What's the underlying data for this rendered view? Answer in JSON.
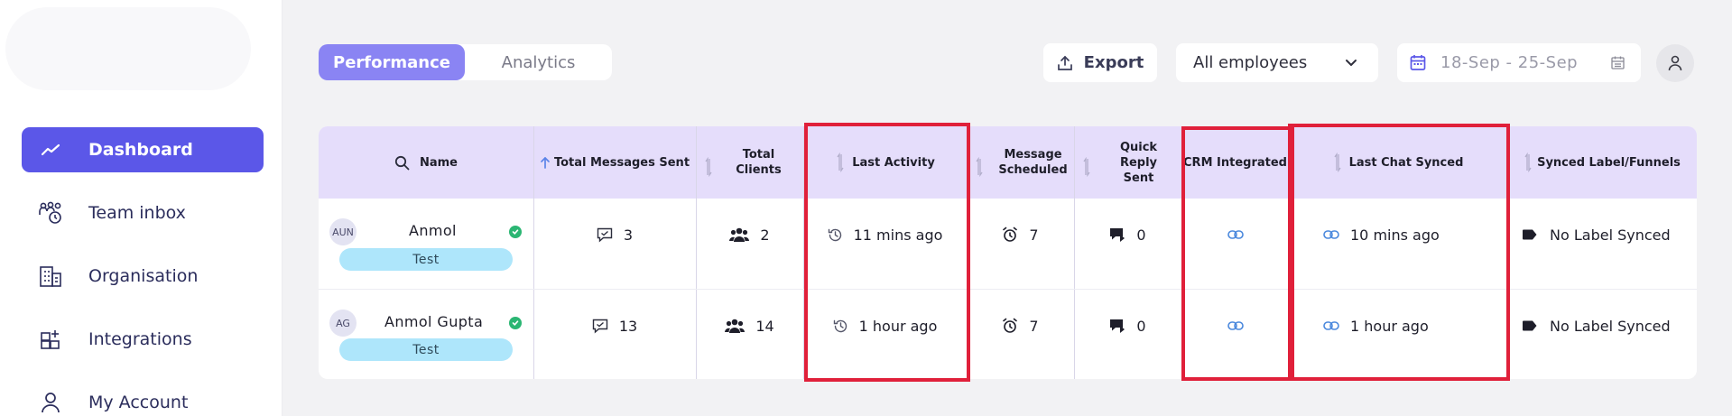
{
  "sidebar": {
    "items": [
      {
        "label": "Dashboard",
        "icon": "trend-line-icon",
        "active": true
      },
      {
        "label": "Team inbox",
        "icon": "team-clock-icon",
        "active": false
      },
      {
        "label": "Organisation",
        "icon": "building-icon",
        "active": false
      },
      {
        "label": "Integrations",
        "icon": "grid-plus-icon",
        "active": false
      },
      {
        "label": "My Account",
        "icon": "user-icon",
        "active": false
      }
    ]
  },
  "topbar": {
    "tabs": [
      {
        "label": "Performance",
        "active": true
      },
      {
        "label": "Analytics",
        "active": false
      }
    ],
    "export_label": "Export",
    "employee_filter": "All employees",
    "date_range": "18-Sep - 25-Sep"
  },
  "table": {
    "headers": {
      "name": "Name",
      "total_messages": "Total Messages Sent",
      "total_clients": "Total Clients",
      "last_activity": "Last Activity",
      "message_scheduled": "Message Scheduled",
      "quick_reply": "Quick Reply Sent",
      "crm": "CRM Integrated",
      "last_chat_synced": "Last Chat Synced",
      "synced_label": "Synced Label/Funnels"
    },
    "rows": [
      {
        "initials": "AUN",
        "name": "Anmol",
        "tag": "Test",
        "messages_sent": "3",
        "clients": "2",
        "last_activity": "11 mins ago",
        "scheduled": "7",
        "quick_reply": "0",
        "last_chat_synced": "10 mins ago",
        "synced_label": "No Label Synced"
      },
      {
        "initials": "AG",
        "name": "Anmol Gupta",
        "tag": "Test",
        "messages_sent": "13",
        "clients": "14",
        "last_activity": "1 hour ago",
        "scheduled": "7",
        "quick_reply": "0",
        "last_chat_synced": "1 hour ago",
        "synced_label": "No Label Synced"
      }
    ]
  },
  "colors": {
    "accent": "#5b57e8",
    "tab_active": "#8a84f3",
    "header_bg": "#e5ddfb",
    "tag_bg": "#aee6fb",
    "highlight_box": "#e0203a",
    "status_green": "#2bb673"
  }
}
